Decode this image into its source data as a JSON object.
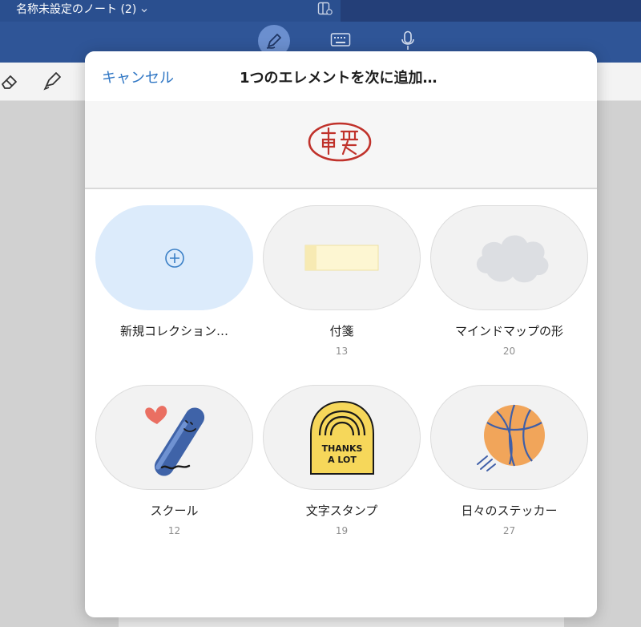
{
  "app": {
    "note_title": "名称未設定のノート (2)",
    "modes": [
      "pen-mode",
      "keyboard-mode",
      "microphone-mode"
    ],
    "colors": {
      "header": "#2f5597",
      "accent": "#2f76c4"
    }
  },
  "toolbar": {
    "tools": [
      "eraser-icon",
      "marker-icon"
    ]
  },
  "modal": {
    "cancel_label": "キャンセル",
    "title": "1つのエレメントを次に追加…",
    "preview_item": "stamp-sticker"
  },
  "collections": [
    {
      "label": "新規コレクション…",
      "count": "",
      "icon": "plus-circle-icon"
    },
    {
      "label": "付箋",
      "count": "13",
      "icon": "sticky-note-icon"
    },
    {
      "label": "マインドマップの形",
      "count": "20",
      "icon": "cloud-shape-icon"
    },
    {
      "label": "スクール",
      "count": "12",
      "icon": "pen-with-heart-icon"
    },
    {
      "label": "文字スタンプ",
      "count": "19",
      "icon": "thanks-a-lot-stamp-icon"
    },
    {
      "label": "日々のステッカー",
      "count": "27",
      "icon": "basketball-icon"
    }
  ]
}
